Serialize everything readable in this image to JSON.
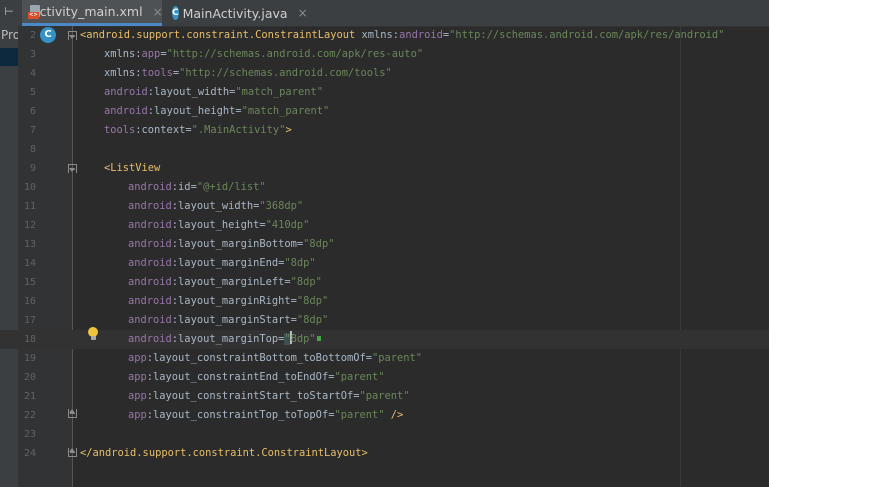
{
  "tabs": [
    {
      "label": "activity_main.xml",
      "icon": "xml-file-icon",
      "active": true
    },
    {
      "label": "MainActivity.java",
      "icon": "java-class-icon",
      "active": false
    }
  ],
  "tab_close_glyph": "×",
  "project_panel": {
    "label": "Pro",
    "collapse_glyph": "⊢"
  },
  "gutter": {
    "class_icon_letter": "C"
  },
  "tabs_icons": {
    "java_letter": "C",
    "xml_badge": "<>"
  },
  "line_numbers": [
    "2",
    "3",
    "4",
    "5",
    "6",
    "7",
    "8",
    "9",
    "10",
    "11",
    "12",
    "13",
    "14",
    "15",
    "16",
    "17",
    "18",
    "19",
    "20",
    "21",
    "22",
    "23",
    "24"
  ],
  "code": {
    "l2": {
      "open": "<",
      "tag": "android.support.constraint.ConstraintLayout",
      "sp": " ",
      "xmlns": "xmlns:",
      "ns": "android",
      "eq": "=",
      "val": "\"http://schemas.android.com/apk/res/android\""
    },
    "l3": {
      "xmlns": "xmlns:",
      "ns": "app",
      "eq": "=",
      "val": "\"http://schemas.android.com/apk/res-auto\""
    },
    "l4": {
      "xmlns": "xmlns:",
      "ns": "tools",
      "eq": "=",
      "val": "\"http://schemas.android.com/tools\""
    },
    "l5": {
      "ns": "android",
      "attr": ":layout_width=",
      "val": "\"match_parent\""
    },
    "l6": {
      "ns": "android",
      "attr": ":layout_height=",
      "val": "\"match_parent\""
    },
    "l7": {
      "ns": "tools",
      "attr": ":context=",
      "val": "\".MainActivity\"",
      "close": ">"
    },
    "l9": {
      "tag": "<ListView"
    },
    "l10": {
      "ns": "android",
      "attr": ":id=",
      "val": "\"@+id/list\""
    },
    "l11": {
      "ns": "android",
      "attr": ":layout_width=",
      "val": "\"368dp\""
    },
    "l12": {
      "ns": "android",
      "attr": ":layout_height=",
      "val": "\"410dp\""
    },
    "l13": {
      "ns": "android",
      "attr": ":layout_marginBottom=",
      "val": "\"8dp\""
    },
    "l14": {
      "ns": "android",
      "attr": ":layout_marginEnd=",
      "val": "\"8dp\""
    },
    "l15": {
      "ns": "android",
      "attr": ":layout_marginLeft=",
      "val": "\"8dp\""
    },
    "l16": {
      "ns": "android",
      "attr": ":layout_marginRight=",
      "val": "\"8dp\""
    },
    "l17": {
      "ns": "android",
      "attr": ":layout_marginStart=",
      "val": "\"8dp\""
    },
    "l18": {
      "ns": "android",
      "attr": ":layout_marginTop=",
      "q1": "\"",
      "val": "8dp\""
    },
    "l19": {
      "ns": "app",
      "attr": ":layout_constraintBottom_toBottomOf=",
      "val": "\"parent\""
    },
    "l20": {
      "ns": "app",
      "attr": ":layout_constraintEnd_toEndOf=",
      "val": "\"parent\""
    },
    "l21": {
      "ns": "app",
      "attr": ":layout_constraintStart_toStartOf=",
      "val": "\"parent\""
    },
    "l22": {
      "ns": "app",
      "attr": ":layout_constraintTop_toTopOf=",
      "val": "\"parent\"",
      "close": " />"
    },
    "l24": {
      "tag": "</android.support.constraint.ConstraintLayout>"
    }
  },
  "colors": {
    "editor_bg": "#2b2b2b",
    "tag": "#e8bf6a",
    "namespace": "#9876aa",
    "string": "#6a8759",
    "plain": "#a9b7c6",
    "accent": "#4a88c7"
  }
}
